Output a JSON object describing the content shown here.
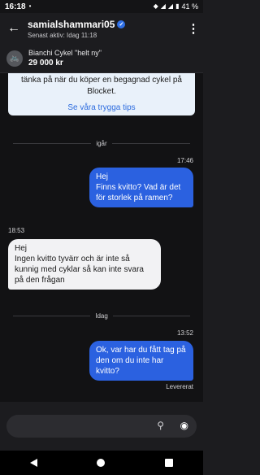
{
  "status_bar": {
    "time": "16:18",
    "battery": "41 %",
    "icons": [
      "notification-dot-icon",
      "wifi-icon",
      "signal-icon",
      "signal-icon-2",
      "battery-icon"
    ]
  },
  "header": {
    "name": "samialshammari05",
    "last_active": "Senast aktiv: Idag 11:18",
    "verified_icon": "check-icon",
    "back_icon": "arrow-left-icon",
    "more_icon": "more-vertical-icon"
  },
  "listing": {
    "title": "Bianchi Cykel \"helt ny\"",
    "price": "29 000 kr"
  },
  "safety_notice": {
    "text": "tänka på när du köper en begagnad cykel på Blocket.",
    "link": "Se våra trygga tips"
  },
  "messages": {
    "day1_label": "igår",
    "day2_label": "Idag",
    "m1_time": "17:46",
    "m1_text": "Hej\nFinns kvitto? Vad är det för storlek på ramen?",
    "m2_time": "18:53",
    "m2_text": "Hej\nIngen kvitto tyvärr och är inte så kunnig med cyklar så kan inte svara på den frågan",
    "m3_time": "13:52",
    "m3_text": "Ok, var har du fått tag på den om du inte har kvitto?",
    "m3_status": "Levererat"
  },
  "composer": {
    "attach_icon": "paperclip-icon",
    "camera_icon": "camera-icon"
  },
  "colors": {
    "outgoing_bubble": "#2b61e0",
    "incoming_bubble": "#f2f2f4",
    "safety_bg": "#e9f1fa",
    "link": "#2d6cdf"
  }
}
